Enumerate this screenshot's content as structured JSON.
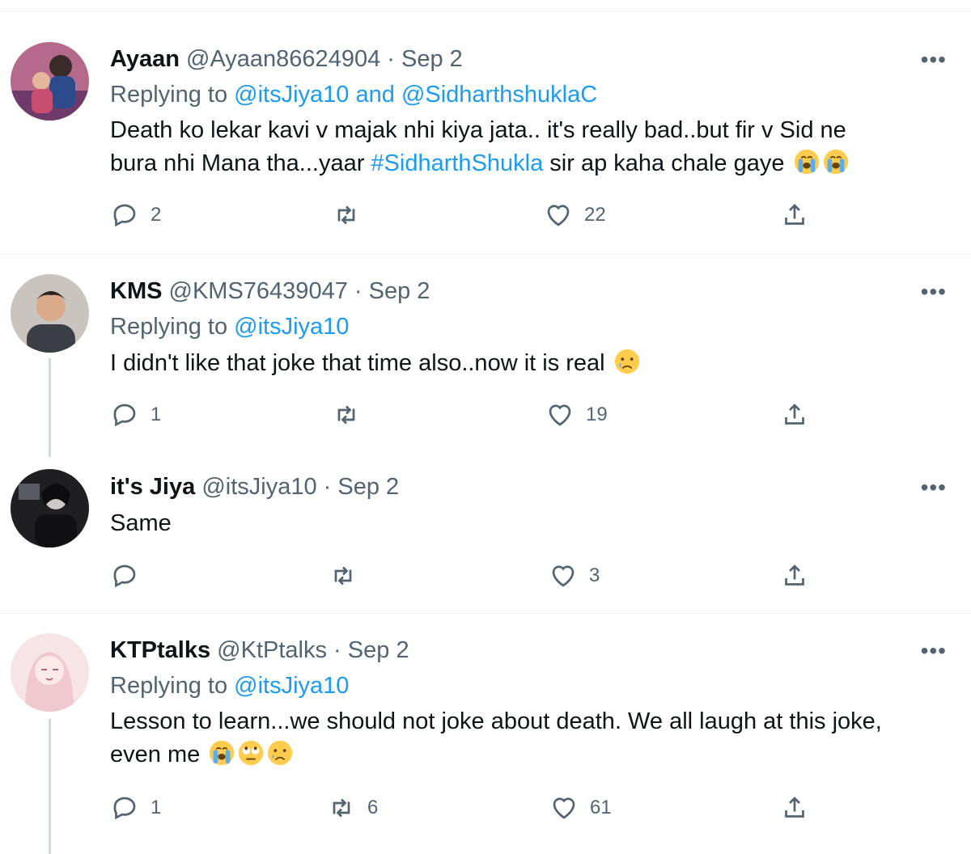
{
  "tweets": [
    {
      "name": "Ayaan",
      "handle": "@Ayaan86624904",
      "date": "Sep 2",
      "replying_prefix": "Replying to ",
      "mention1": "@itsJiya10",
      "connector": " and ",
      "mention2": "@SidharthshuklaC",
      "text_line1": "Death ko lekar kavi v majak nhi kiya jata.. it's really bad..but fir v Sid ne",
      "text_line2_a": "bura nhi Mana tha...yaar ",
      "hashtag": "#SidharthShukla",
      "text_line2_b": " sir ap kaha chale gaye",
      "emojis": [
        "loudly-crying-face",
        "loudly-crying-face"
      ],
      "replies": "2",
      "retweets": "",
      "likes": "22"
    },
    {
      "name": "KMS",
      "handle": "@KMS76439047",
      "date": "Sep 2",
      "replying_prefix": "Replying to ",
      "mention1": "@itsJiya10",
      "text_line1": "I didn't like that joke that time also..now it is real",
      "emojis": [
        "crying-face"
      ],
      "replies": "1",
      "retweets": "",
      "likes": "19"
    },
    {
      "name": "it's Jiya",
      "handle": "@itsJiya10",
      "date": "Sep 2",
      "text_line1": "Same",
      "replies": "",
      "retweets": "",
      "likes": "3"
    },
    {
      "name": "KTPtalks",
      "handle": "@KtPtalks",
      "date": "Sep 2",
      "replying_prefix": "Replying to ",
      "mention1": "@itsJiya10",
      "text_line1": "Lesson to learn...we should not joke about death. We all laugh at this joke,",
      "text_line2_a": "even me",
      "emojis": [
        "loudly-crying-face",
        "face-with-rolling-eyes",
        "crying-face"
      ],
      "replies": "1",
      "retweets": "6",
      "likes": "61"
    }
  ],
  "dot_separator": "·",
  "more_label": "•••",
  "colors": {
    "link": "#1d9bf0",
    "secondary": "#536471",
    "primary": "#0f1419",
    "divider": "#eff3f4"
  }
}
